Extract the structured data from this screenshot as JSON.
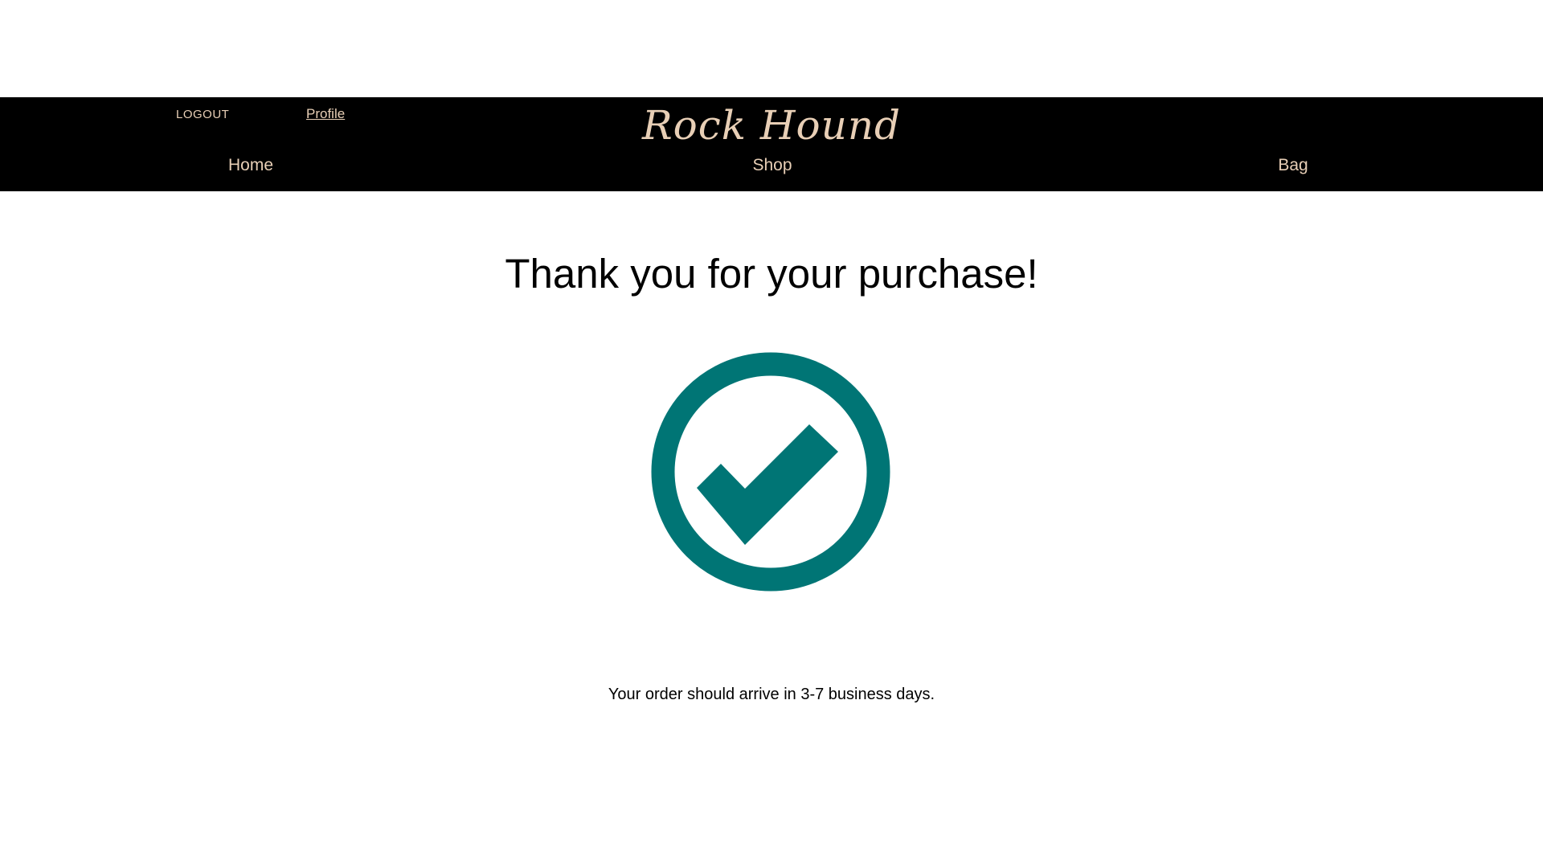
{
  "header": {
    "logout_label": "LOGOUT",
    "profile_label": "Profile",
    "brand": "Rock Hound",
    "nav": {
      "home": "Home",
      "shop": "Shop",
      "bag": "Bag"
    }
  },
  "main": {
    "headline": "Thank you for your purchase!",
    "icon": "check-circle-icon",
    "message": "Your order should arrive in 3-7 business days."
  },
  "colors": {
    "nav_background": "#000000",
    "nav_text": "#e8cfb6",
    "accent": "#007575"
  }
}
